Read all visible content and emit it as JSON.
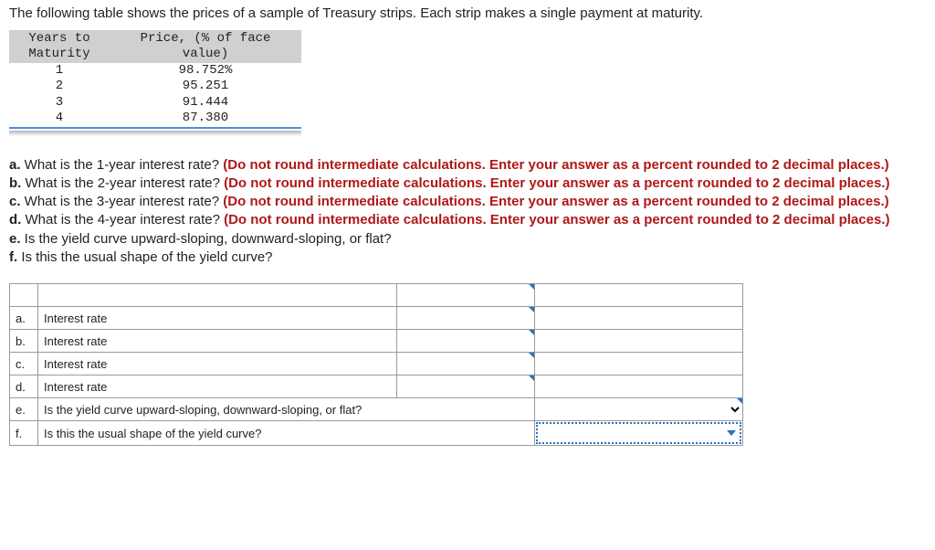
{
  "intro": "The following table shows the prices of a sample of Treasury strips. Each strip makes a single payment at maturity.",
  "strip_table": {
    "headers": {
      "col1_line1": "Years to",
      "col1_line2": "Maturity",
      "col2_line1": "Price, (% of face",
      "col2_line2": "value)"
    },
    "rows": [
      {
        "years": "1",
        "price": "98.752%"
      },
      {
        "years": "2",
        "price": "95.251"
      },
      {
        "years": "3",
        "price": "91.444"
      },
      {
        "years": "4",
        "price": "87.380"
      }
    ]
  },
  "questions": {
    "a_b": "a.",
    "a_q": " What is the 1-year interest rate? ",
    "a_hint": "(Do not round intermediate calculations. Enter your answer as a percent rounded to 2 decimal places.)",
    "b_b": "b.",
    "b_q": " What is the 2-year interest rate? ",
    "b_hint": "(Do not round intermediate calculations. Enter your answer as a percent rounded to 2 decimal places.)",
    "c_b": "c.",
    "c_q": " What is the 3-year interest rate? ",
    "c_hint": "(Do not round intermediate calculations. Enter your answer as a percent rounded to 2 decimal places.)",
    "d_b": "d.",
    "d_q": " What is the 4-year interest rate? ",
    "d_hint": "(Do not round intermediate calculations. Enter your answer as a percent rounded to 2 decimal places.)",
    "e_b": "e.",
    "e_q": " Is the yield curve upward-sloping, downward-sloping, or flat?",
    "f_b": "f.",
    "f_q": " Is this the usual shape of the yield curve?"
  },
  "answer_table": {
    "rows": {
      "a": {
        "letter": "a.",
        "label": "Interest rate"
      },
      "b": {
        "letter": "b.",
        "label": "Interest rate"
      },
      "c": {
        "letter": "c.",
        "label": "Interest rate"
      },
      "d": {
        "letter": "d.",
        "label": "Interest rate"
      },
      "e": {
        "letter": "e.",
        "label": "Is the yield curve upward-sloping, downward-sloping, or flat?"
      },
      "f": {
        "letter": "f.",
        "label": "Is this the usual shape of the yield curve?"
      }
    }
  },
  "chart_data": {
    "type": "table",
    "title": "Treasury strip prices by years to maturity",
    "columns": [
      "Years to Maturity",
      "Price (% of face value)"
    ],
    "rows": [
      [
        1,
        98.752
      ],
      [
        2,
        95.251
      ],
      [
        3,
        91.444
      ],
      [
        4,
        87.38
      ]
    ]
  }
}
